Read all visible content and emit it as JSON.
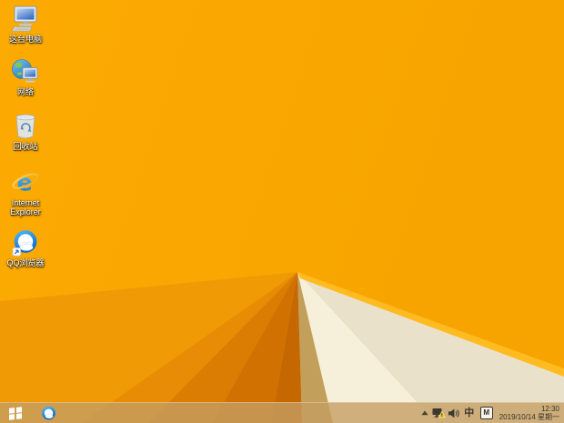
{
  "desktop": {
    "icons": [
      {
        "label": "这台电脑",
        "icon": "computer-icon"
      },
      {
        "label": "网络",
        "icon": "network-globe-icon"
      },
      {
        "label": "回收站",
        "icon": "recycle-bin-icon"
      },
      {
        "label": "Internet Explorer",
        "icon": "internet-explorer-icon"
      },
      {
        "label": "QQ浏览器",
        "icon": "qq-browser-icon"
      }
    ]
  },
  "taskbar": {
    "pinned": [
      {
        "name": "start-button"
      },
      {
        "name": "qq-browser-taskbar-icon"
      }
    ],
    "tray": {
      "ime_mode": "中",
      "ime_badge": "M",
      "time": "12:30",
      "date": "2019/10/14 星期一"
    }
  },
  "colors": {
    "wallpaper_orange": "#FAA601",
    "wallpaper_wedge_dark": "#C66801",
    "wallpaper_cream": "#F4EDD8",
    "wallpaper_cream_shadow": "#C2A05C",
    "ridge_highlight": "#FFBB20",
    "taskbar_tint": "#C49E63",
    "warning_yellow": "#F2C50B",
    "ie_blue": "#1B74CF",
    "qq_blue": "#1E8FE0",
    "screen_blue": "#3A6FC0",
    "label_text": "#FFFFFF",
    "tray_glyph": "#3B382F"
  }
}
